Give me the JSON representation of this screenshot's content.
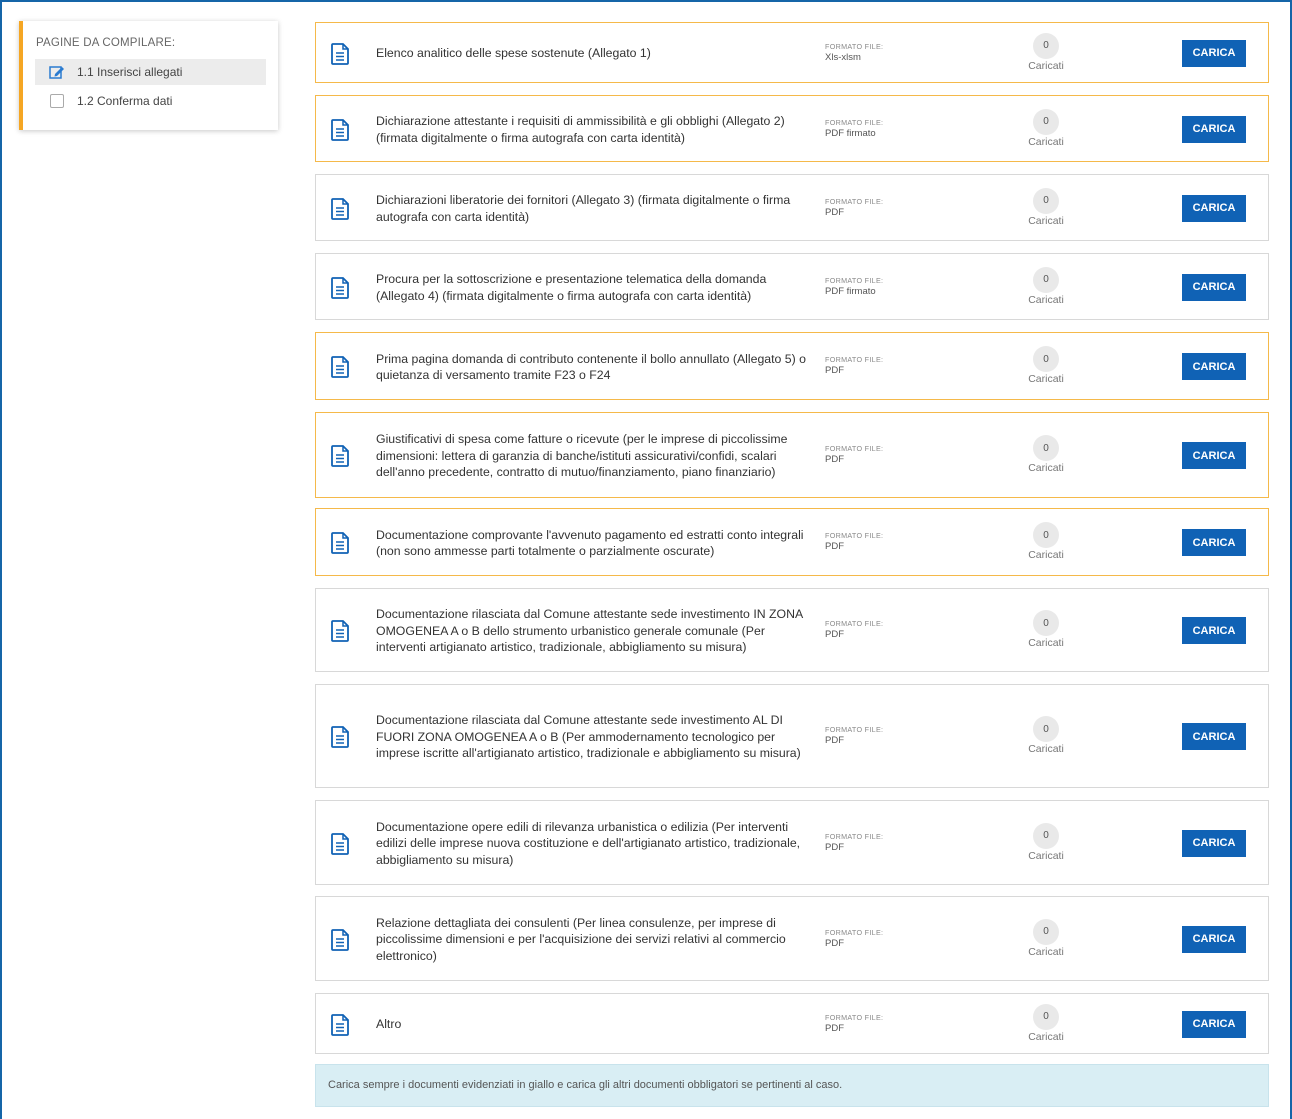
{
  "sidebar": {
    "title": "PAGINE DA COMPILARE:",
    "items": [
      {
        "label": "1.1 Inserisci allegati",
        "icon": "edit-icon",
        "active": true
      },
      {
        "label": "1.2 Conferma dati",
        "icon": "checkbox",
        "active": false
      }
    ]
  },
  "format_label": "FORMATO FILE:",
  "uploaded_label": "Caricati",
  "upload_button_label": "CARICA",
  "colors": {
    "required_border": "#f5b94a",
    "accent": "#f5a623",
    "button": "#1062b5",
    "note_bg": "#d9eef4"
  },
  "documents": [
    {
      "title": "Elenco analitico delle spese sostenute (Allegato 1)",
      "format": "Xls-xlsm",
      "count": "0",
      "required": true
    },
    {
      "title": "Dichiarazione attestante i requisiti di ammissibilità e gli obblighi (Allegato 2) (firmata digitalmente o firma autografa con carta identità)",
      "format": "PDF firmato",
      "count": "0",
      "required": true
    },
    {
      "title": "Dichiarazioni liberatorie dei fornitori (Allegato 3) (firmata digitalmente o firma autografa con carta identità)",
      "format": "PDF",
      "count": "0",
      "required": false
    },
    {
      "title": "Procura per la sottoscrizione e presentazione telematica della domanda (Allegato 4) (firmata digitalmente o firma autografa con carta identità)",
      "format": "PDF firmato",
      "count": "0",
      "required": false
    },
    {
      "title": "Prima pagina domanda di contributo contenente il bollo annullato (Allegato 5) o quietanza di versamento tramite F23 o F24",
      "format": "PDF",
      "count": "0",
      "required": true
    },
    {
      "title": "Giustificativi di spesa come fatture o ricevute (per le imprese di piccolissime dimensioni: lettera di garanzia di banche/istituti assicurativi/confidi, scalari dell'anno precedente, contratto di mutuo/finanziamento, piano finanziario)",
      "format": "PDF",
      "count": "0",
      "required": true
    },
    {
      "title": "Documentazione comprovante l'avvenuto pagamento ed estratti conto integrali (non sono ammesse parti totalmente o parzialmente oscurate)",
      "format": "PDF",
      "count": "0",
      "required": true
    },
    {
      "title": "Documentazione rilasciata dal Comune attestante sede investimento IN ZONA OMOGENEA A o B dello strumento urbanistico generale comunale (Per interventi artigianato artistico, tradizionale, abbigliamento su misura)",
      "format": "PDF",
      "count": "0",
      "required": false
    },
    {
      "title": "Documentazione rilasciata dal Comune attestante sede investimento AL DI FUORI ZONA OMOGENEA A o B (Per ammodernamento tecnologico per imprese iscritte all'artigianato artistico, tradizionale e abbigliamento su misura)",
      "format": "PDF",
      "count": "0",
      "required": false
    },
    {
      "title": "Documentazione opere edili di rilevanza urbanistica o edilizia (Per interventi edilizi delle imprese nuova costituzione e dell'artigianato artistico, tradizionale, abbigliamento su misura)",
      "format": "PDF",
      "count": "0",
      "required": false
    },
    {
      "title": "Relazione dettagliata dei consulenti (Per linea consulenze, per imprese di piccolissime dimensioni e per l'acquisizione dei servizi relativi al commercio elettronico)",
      "format": "PDF",
      "count": "0",
      "required": false
    },
    {
      "title": "Altro",
      "format": "PDF",
      "count": "0",
      "required": false
    }
  ],
  "note": "Carica sempre i documenti evidenziati in giallo e carica gli altri documenti obbligatori se pertinenti al caso."
}
